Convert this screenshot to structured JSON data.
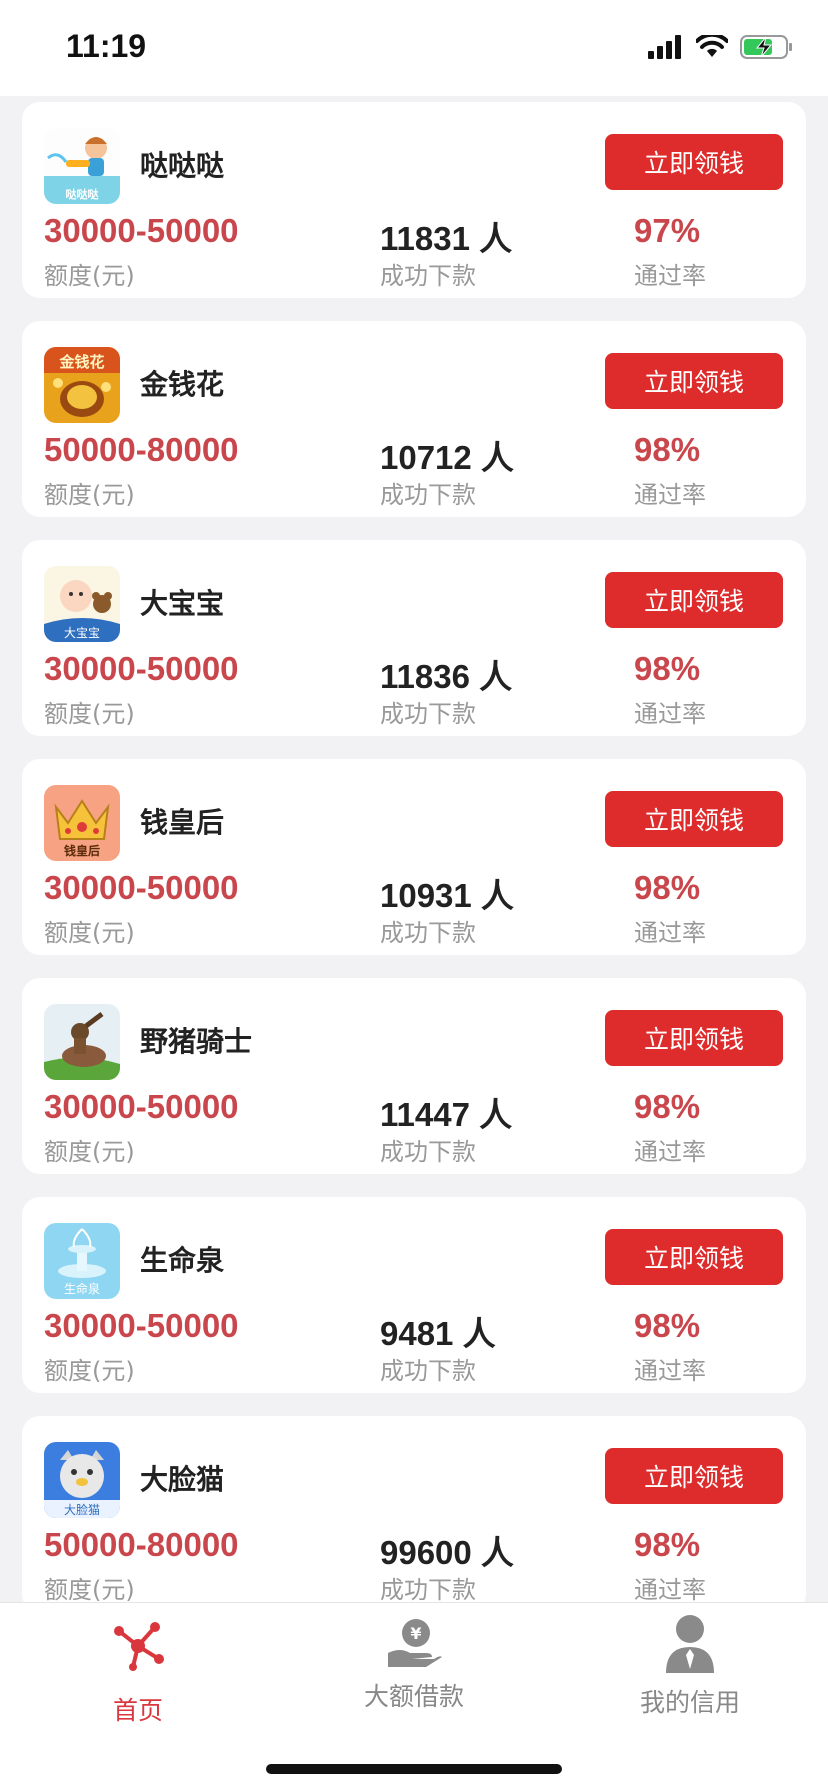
{
  "status": {
    "time": "11:19"
  },
  "card_labels": {
    "amount_unit": "额度(元)",
    "count_unit": "成功下款",
    "rate_unit": "通过率",
    "button": "立即领钱"
  },
  "apps": [
    {
      "name": "哒哒哒",
      "amount": "30000-50000",
      "count": "11831 人",
      "rate": "97%",
      "icon": "boy-watergun-icon",
      "icon_text": "哒哒哒"
    },
    {
      "name": "金钱花",
      "amount": "50000-80000",
      "count": "10712 人",
      "rate": "98%",
      "icon": "money-bag-icon",
      "icon_text": "金钱花"
    },
    {
      "name": "大宝宝",
      "amount": "30000-50000",
      "count": "11836 人",
      "rate": "98%",
      "icon": "baby-bear-icon",
      "icon_text": "大宝宝"
    },
    {
      "name": "钱皇后",
      "amount": "30000-50000",
      "count": "10931 人",
      "rate": "98%",
      "icon": "crown-icon",
      "icon_text": "钱皇后"
    },
    {
      "name": "野猪骑士",
      "amount": "30000-50000",
      "count": "11447 人",
      "rate": "98%",
      "icon": "boar-rider-icon",
      "icon_text": ""
    },
    {
      "name": "生命泉",
      "amount": "30000-50000",
      "count": "9481 人",
      "rate": "98%",
      "icon": "fountain-icon",
      "icon_text": "生命泉"
    },
    {
      "name": "大脸猫",
      "amount": "50000-80000",
      "count": "99600 人",
      "rate": "98%",
      "icon": "cat-face-icon",
      "icon_text": "大脸猫"
    }
  ],
  "tabs": [
    {
      "label": "首页",
      "icon": "network-icon",
      "active": true
    },
    {
      "label": "大额借款",
      "icon": "hand-coin-icon",
      "active": false
    },
    {
      "label": "我的信用",
      "icon": "person-icon",
      "active": false
    }
  ],
  "colors": {
    "accent": "#de2c2c",
    "amount": "#c9474c",
    "active_tab": "#d9363d"
  }
}
